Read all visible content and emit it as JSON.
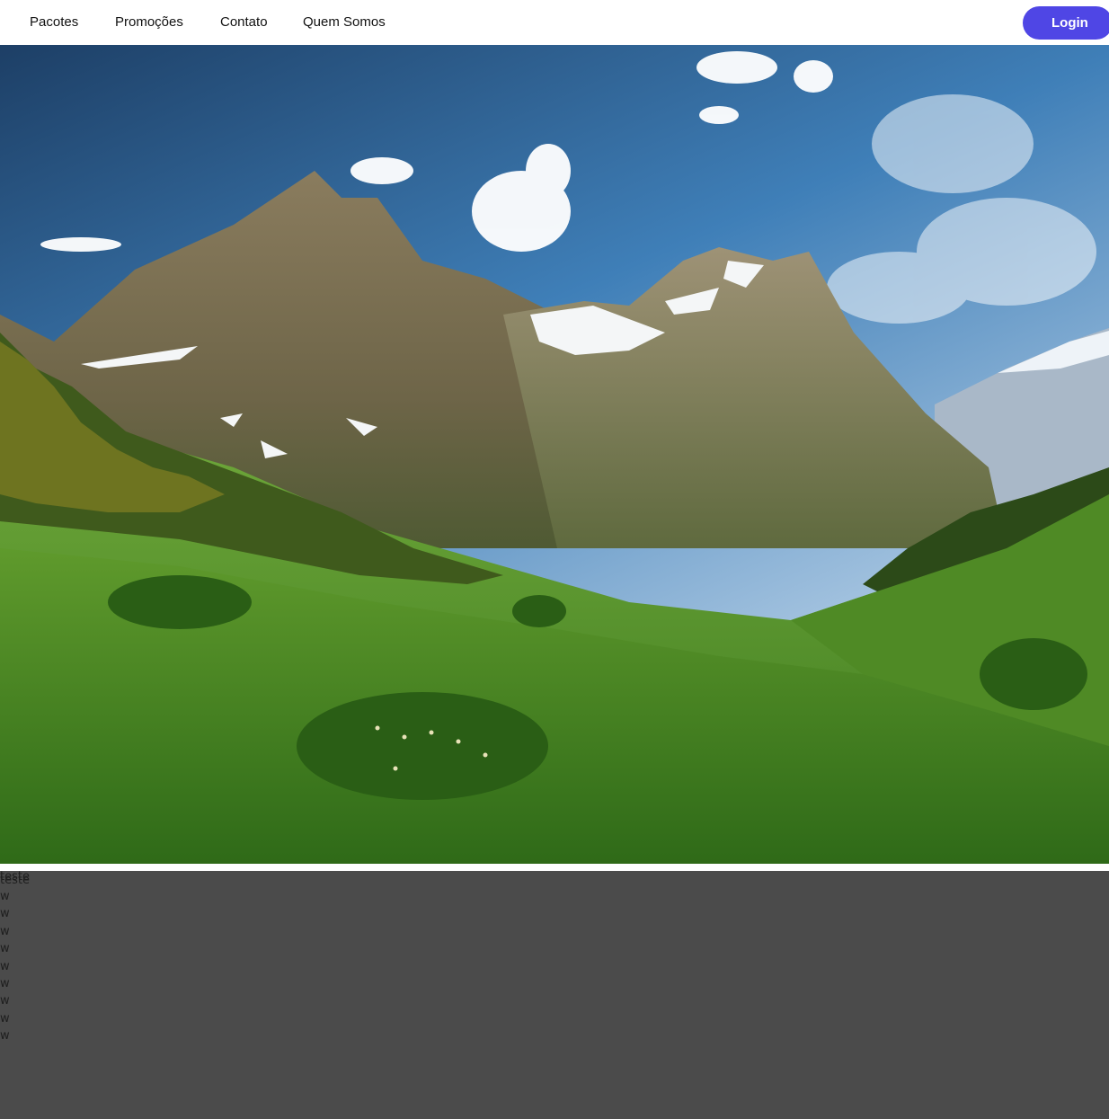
{
  "nav": {
    "items": [
      "Pacotes",
      "Promoções",
      "Contato",
      "Quem Somos"
    ],
    "login_label": "Login"
  },
  "hero": {
    "image": "mountain-valley-landscape-photo"
  },
  "content": {
    "teste_1": "teste",
    "teste_2": "teste",
    "lines": [
      "w",
      "w",
      "w",
      "w",
      "w",
      "w",
      "w",
      "w",
      "w"
    ]
  },
  "colors": {
    "login_bg": "#4f46e5",
    "page_bg": "#4b4b4b",
    "topbar_bg": "#ffffff"
  }
}
